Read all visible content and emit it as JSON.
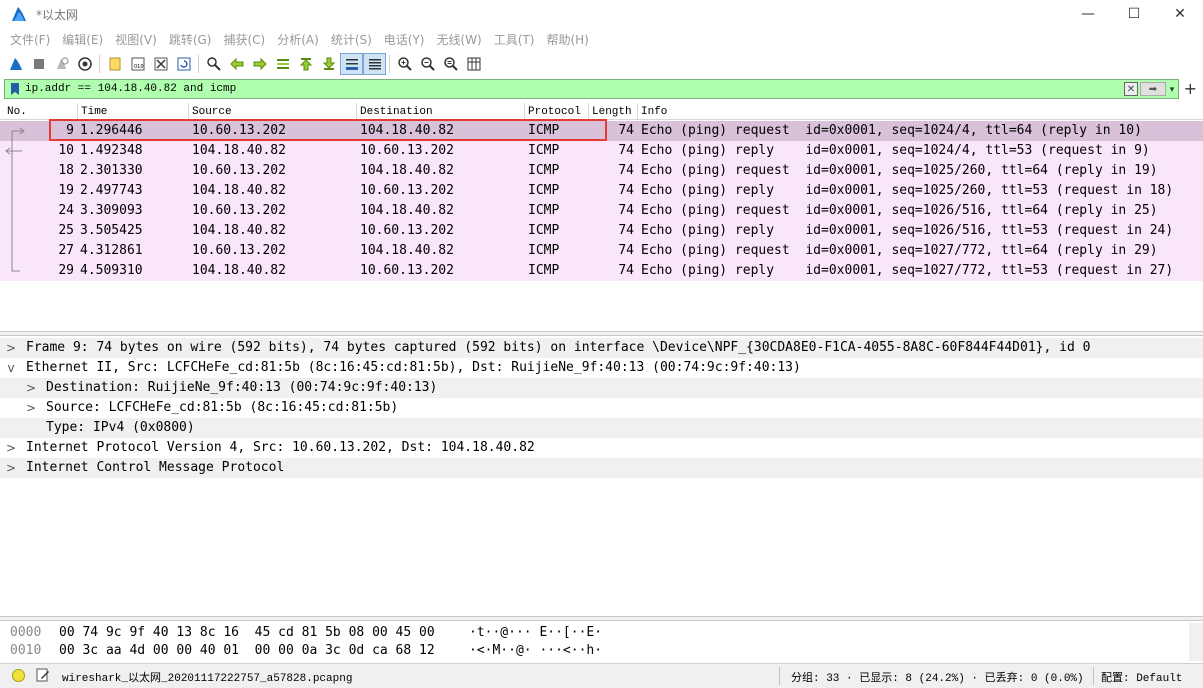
{
  "window": {
    "title": "*以太网",
    "minimize": "—",
    "maximize": "☐",
    "close": "✕"
  },
  "menu": [
    "文件(F)",
    "编辑(E)",
    "视图(V)",
    "跳转(G)",
    "捕获(C)",
    "分析(A)",
    "统计(S)",
    "电话(Y)",
    "无线(W)",
    "工具(T)",
    "帮助(H)"
  ],
  "toolbar": {
    "icons": [
      "shark-fin-start-icon",
      "stop-capture-icon",
      "restart-capture-icon",
      "capture-options-icon",
      "open-file-icon",
      "save-file-icon",
      "close-file-icon",
      "reload-file-icon",
      "find-packet-icon",
      "go-back-icon",
      "go-forward-icon",
      "go-to-packet-icon",
      "go-first-icon",
      "go-last-icon",
      "autoscroll-icon",
      "colorize-icon",
      "zoom-in-icon",
      "zoom-out-icon",
      "zoom-normal-icon",
      "resize-columns-icon"
    ]
  },
  "filter": {
    "value": "ip.addr == 104.18.40.82 and icmp",
    "clear_icon": "✕",
    "apply_icon": "➡",
    "dropdown_icon": "▾",
    "add_button": "+"
  },
  "columns": [
    "No.",
    "Time",
    "Source",
    "Destination",
    "Protocol",
    "Length",
    "Info"
  ],
  "packets": [
    {
      "no": "9",
      "time": "1.296446",
      "src": "10.60.13.202",
      "dst": "104.18.40.82",
      "proto": "ICMP",
      "len": "74",
      "info": "Echo (ping) request  id=0x0001, seq=1024/4, ttl=64 (reply in 10)"
    },
    {
      "no": "10",
      "time": "1.492348",
      "src": "104.18.40.82",
      "dst": "10.60.13.202",
      "proto": "ICMP",
      "len": "74",
      "info": "Echo (ping) reply    id=0x0001, seq=1024/4, ttl=53 (request in 9)"
    },
    {
      "no": "18",
      "time": "2.301330",
      "src": "10.60.13.202",
      "dst": "104.18.40.82",
      "proto": "ICMP",
      "len": "74",
      "info": "Echo (ping) request  id=0x0001, seq=1025/260, ttl=64 (reply in 19)"
    },
    {
      "no": "19",
      "time": "2.497743",
      "src": "104.18.40.82",
      "dst": "10.60.13.202",
      "proto": "ICMP",
      "len": "74",
      "info": "Echo (ping) reply    id=0x0001, seq=1025/260, ttl=53 (request in 18)"
    },
    {
      "no": "24",
      "time": "3.309093",
      "src": "10.60.13.202",
      "dst": "104.18.40.82",
      "proto": "ICMP",
      "len": "74",
      "info": "Echo (ping) request  id=0x0001, seq=1026/516, ttl=64 (reply in 25)"
    },
    {
      "no": "25",
      "time": "3.505425",
      "src": "104.18.40.82",
      "dst": "10.60.13.202",
      "proto": "ICMP",
      "len": "74",
      "info": "Echo (ping) reply    id=0x0001, seq=1026/516, ttl=53 (request in 24)"
    },
    {
      "no": "27",
      "time": "4.312861",
      "src": "10.60.13.202",
      "dst": "104.18.40.82",
      "proto": "ICMP",
      "len": "74",
      "info": "Echo (ping) request  id=0x0001, seq=1027/772, ttl=64 (reply in 29)"
    },
    {
      "no": "29",
      "time": "4.509310",
      "src": "104.18.40.82",
      "dst": "10.60.13.202",
      "proto": "ICMP",
      "len": "74",
      "info": "Echo (ping) reply    id=0x0001, seq=1027/772, ttl=53 (request in 27)"
    }
  ],
  "selected_packet": "9",
  "colors": {
    "filter_valid": "#afffaf",
    "row_icmp": "#fae6fa",
    "row_selected": "#d9c1d9",
    "highlight_border": "#e53935"
  },
  "details": [
    {
      "caret": ">",
      "text": "Frame 9: 74 bytes on wire (592 bits), 74 bytes captured (592 bits) on interface \\Device\\NPF_{30CDA8E0-F1CA-4055-8A8C-60F844F44D01}, id 0"
    },
    {
      "caret": "v",
      "text": "Ethernet II, Src: LCFCHeFe_cd:81:5b (8c:16:45:cd:81:5b), Dst: RuijieNe_9f:40:13 (00:74:9c:9f:40:13)"
    },
    {
      "caret": ">",
      "text": "Destination: RuijieNe_9f:40:13 (00:74:9c:9f:40:13)"
    },
    {
      "caret": ">",
      "text": "Source: LCFCHeFe_cd:81:5b (8c:16:45:cd:81:5b)"
    },
    {
      "caret": "",
      "text": "Type: IPv4 (0x0800)"
    },
    {
      "caret": ">",
      "text": "Internet Protocol Version 4, Src: 10.60.13.202, Dst: 104.18.40.82"
    },
    {
      "caret": ">",
      "text": "Internet Control Message Protocol"
    }
  ],
  "bytes": [
    {
      "offset": "0000",
      "hex": "00 74 9c 9f 40 13 8c 16  45 cd 81 5b 08 00 45 00",
      "ascii": "·t··@··· E··[··E·"
    },
    {
      "offset": "0010",
      "hex": "00 3c aa 4d 00 00 40 01  00 00 0a 3c 0d ca 68 12",
      "ascii": "·<·M··@· ···<··h·"
    }
  ],
  "status": {
    "file": "wireshark_以太网_20201117222757_a57828.pcapng",
    "stats": "分组: 33 · 已显示: 8 (24.2%) · 已丢弃: 0 (0.0%)",
    "profile": "配置: Default"
  }
}
